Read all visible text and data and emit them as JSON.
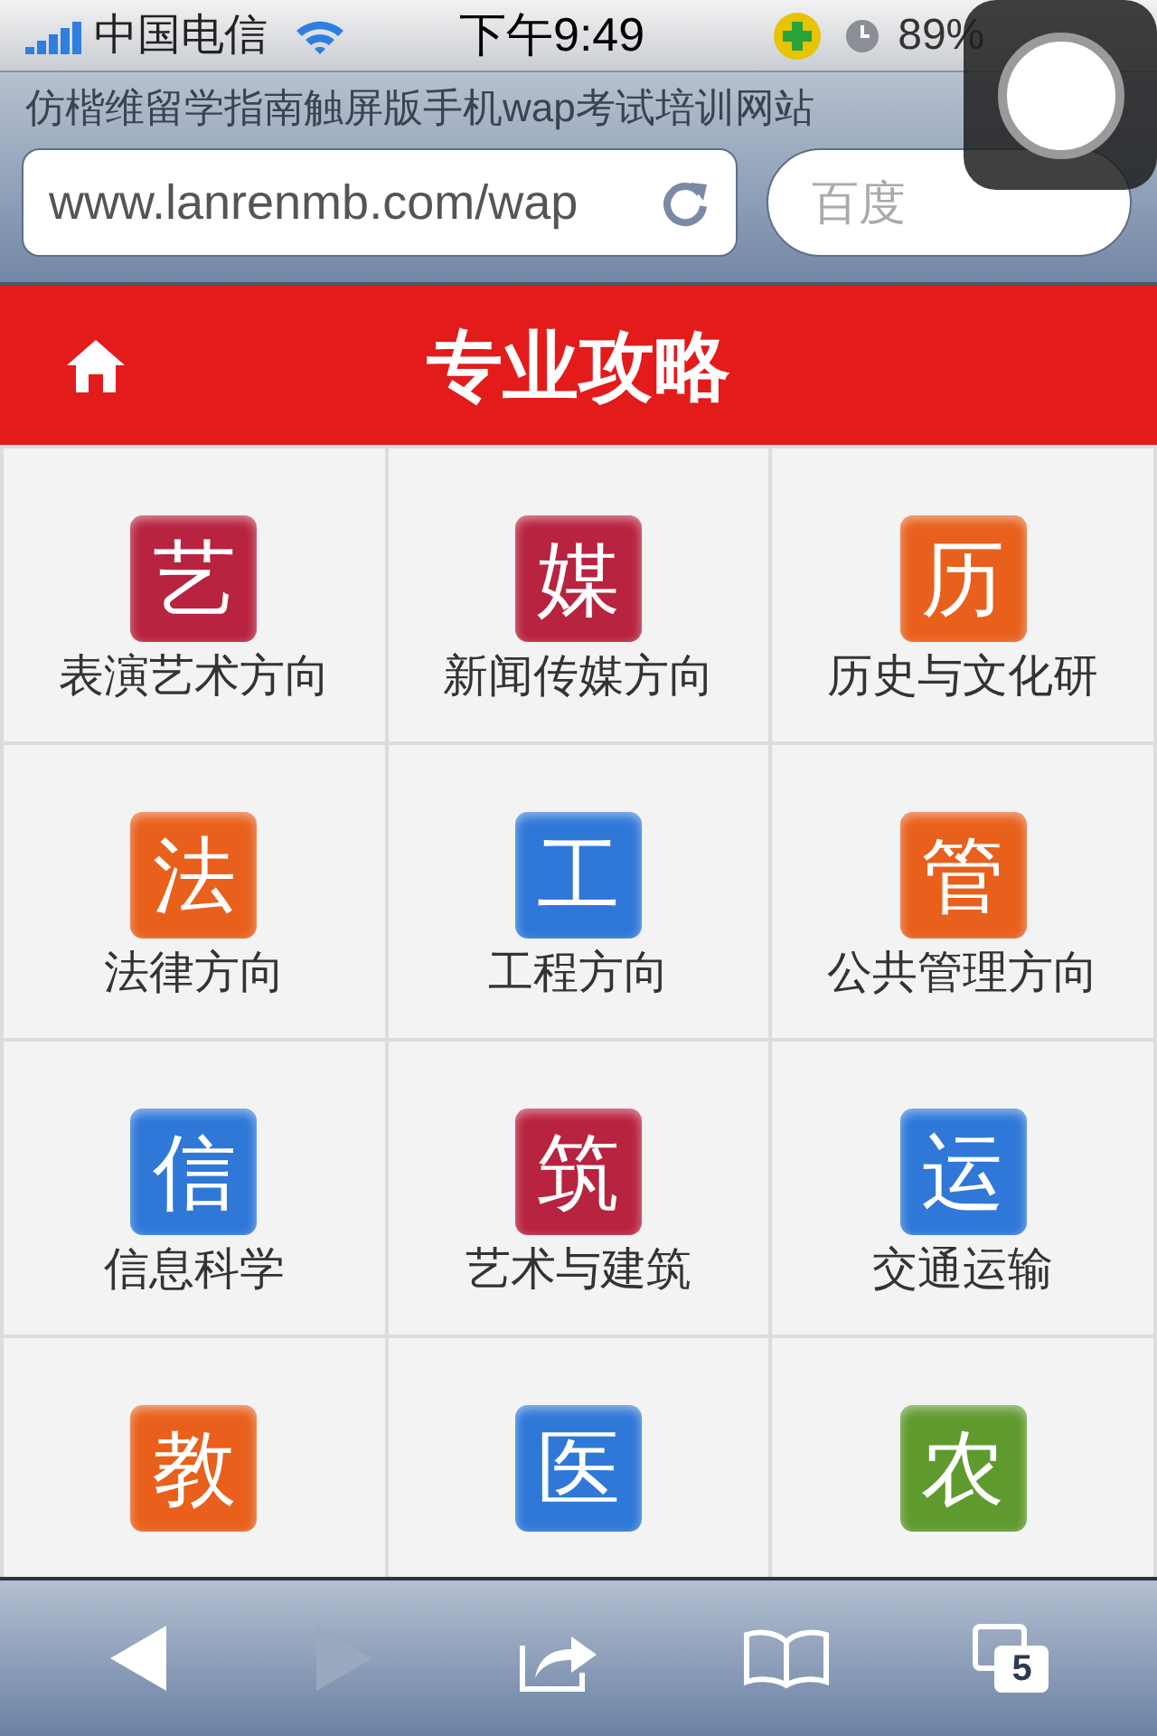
{
  "status_bar": {
    "carrier": "中国电信",
    "time": "下午9:49",
    "battery": "89%"
  },
  "browser": {
    "page_title": "仿楷维留学指南触屏版手机wap考试培训网站",
    "url": "www.lanrenmb.com/wap",
    "search": {
      "placeholder": "百度"
    }
  },
  "header": {
    "title": "专业攻略"
  },
  "categories": [
    {
      "glyph": "艺",
      "color": "#b8233f",
      "label": "表演艺术方向"
    },
    {
      "glyph": "媒",
      "color": "#b8233f",
      "label": "新闻传媒方向"
    },
    {
      "glyph": "历",
      "color": "#e8601c",
      "label": "历史与文化研"
    },
    {
      "glyph": "法",
      "color": "#e8601c",
      "label": "法律方向"
    },
    {
      "glyph": "工",
      "color": "#2f78d8",
      "label": "工程方向"
    },
    {
      "glyph": "管",
      "color": "#e8601c",
      "label": "公共管理方向"
    },
    {
      "glyph": "信",
      "color": "#2f78d8",
      "label": "信息科学"
    },
    {
      "glyph": "筑",
      "color": "#b8233f",
      "label": "艺术与建筑"
    },
    {
      "glyph": "运",
      "color": "#2f78d8",
      "label": "交通运输"
    },
    {
      "glyph": "教",
      "color": "#e8601c"
    },
    {
      "glyph": "医",
      "color": "#2f78d8"
    },
    {
      "glyph": "农",
      "color": "#5f9a2e"
    }
  ],
  "toolbar": {
    "tabs_count": "5"
  }
}
